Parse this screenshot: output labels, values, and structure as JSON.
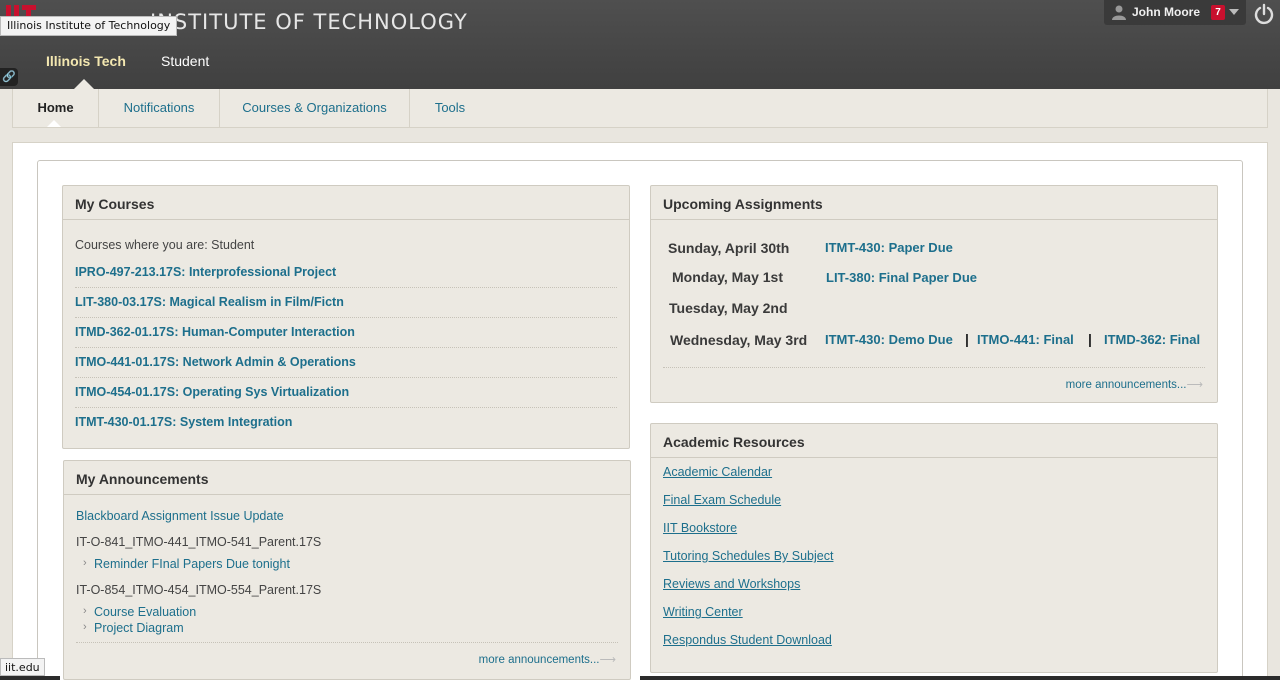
{
  "header": {
    "brand_text": "INSTITUTE OF TECHNOLOGY",
    "tooltip": "Illinois Institute of Technology",
    "tabs": [
      {
        "label": "Illinois Tech"
      },
      {
        "label": "Student"
      }
    ],
    "user": {
      "name": "John Moore",
      "notification_count": "7"
    }
  },
  "nav": {
    "tabs": [
      {
        "label": "Home"
      },
      {
        "label": "Notifications"
      },
      {
        "label": "Courses & Organizations"
      },
      {
        "label": "Tools"
      }
    ]
  },
  "my_courses": {
    "title": "My Courses",
    "role_text": "Courses where you are: Student",
    "courses": [
      "IPRO-497-213.17S: Interprofessional Project",
      "LIT-380-03.17S: Magical Realism in Film/Fictn",
      "ITMD-362-01.17S: Human-Computer Interaction",
      "ITMO-441-01.17S: Network Admin & Operations",
      "ITMO-454-01.17S: Operating Sys Virtualization",
      "ITMT-430-01.17S: System Integration"
    ]
  },
  "my_announcements": {
    "title": "My Announcements",
    "top_link": "Blackboard Assignment Issue Update",
    "groups": [
      {
        "course": "IT-O-841_ITMO-441_ITMO-541_Parent.17S",
        "items": [
          "Reminder FInal Papers Due tonight"
        ]
      },
      {
        "course": "IT-O-854_ITMO-454_ITMO-554_Parent.17S",
        "items": [
          "Course Evaluation",
          "Project Diagram"
        ]
      }
    ],
    "more": "more announcements..."
  },
  "upcoming": {
    "title": "Upcoming Assignments",
    "days": [
      {
        "date": "Sunday, April 30th",
        "items": [
          "ITMT-430: Paper Due"
        ]
      },
      {
        "date": "Monday, May 1st",
        "items": [
          "LIT-380: Final Paper Due"
        ]
      },
      {
        "date": "Tuesday, May 2nd",
        "items": []
      },
      {
        "date": "Wednesday, May 3rd",
        "items": [
          "ITMT-430: Demo Due",
          "ITMO-441: Final",
          "ITMD-362: Final"
        ]
      }
    ],
    "separator": "|",
    "more": "more announcements..."
  },
  "academic_resources": {
    "title": "Academic Resources",
    "links": [
      "Academic Calendar",
      "Final Exam Schedule",
      "IIT Bookstore ",
      "Tutoring Schedules By Subject",
      "Reviews and Workshops",
      "Writing Center",
      "Respondus Student Download"
    ]
  },
  "status_bar": {
    "url": "iit.edu"
  },
  "colors": {
    "link": "#1d6f8c",
    "header_bg": "#474747",
    "badge": "#c8102e",
    "active_tab": "#f3e7b0"
  }
}
